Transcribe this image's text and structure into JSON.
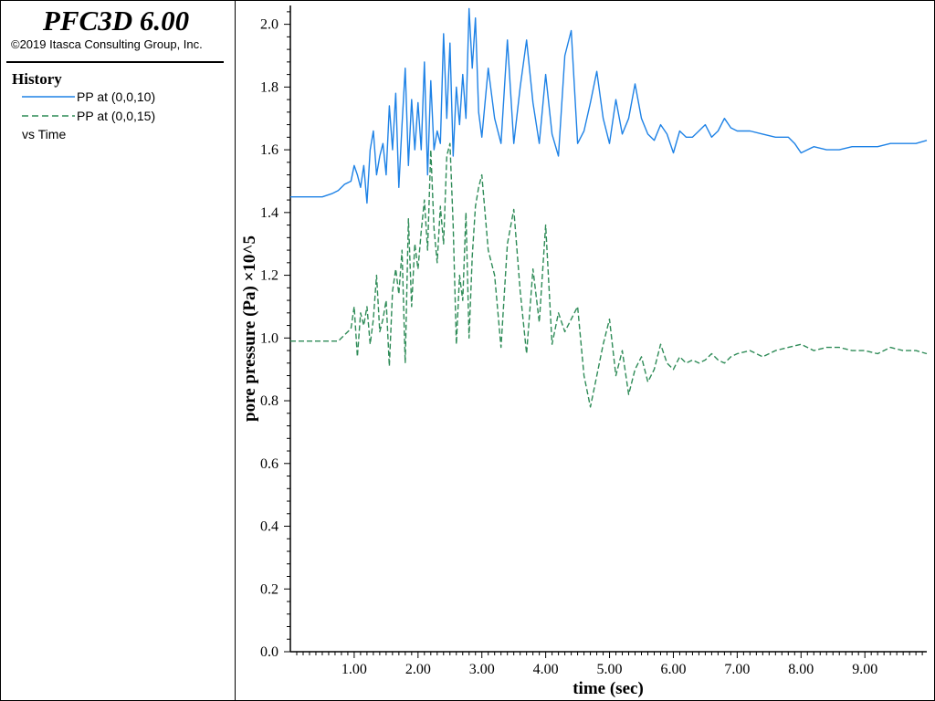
{
  "header": {
    "app_title": "PFC3D 6.00",
    "copyright": "©2019 Itasca Consulting Group, Inc."
  },
  "legend": {
    "heading": "History",
    "items": [
      {
        "label": "PP at (0,0,10)",
        "color": "#1e82e6",
        "style": "solid"
      },
      {
        "label": "PP at (0,0,15)",
        "color": "#2e8b57",
        "style": "dashed"
      }
    ],
    "vs_label": "vs Time"
  },
  "chart_data": {
    "type": "line",
    "xlabel": "time (sec)",
    "ylabel": "pore pressure (Pa) ×10^5",
    "xlim": [
      0,
      9.97
    ],
    "ylim": [
      0,
      2.06
    ],
    "xticks": [
      1,
      2,
      3,
      4,
      5,
      6,
      7,
      8,
      9
    ],
    "xtick_labels": [
      "1.00",
      "2.00",
      "3.00",
      "4.00",
      "5.00",
      "6.00",
      "7.00",
      "8.00",
      "9.00"
    ],
    "yticks": [
      0,
      0.2,
      0.4,
      0.6,
      0.8,
      1.0,
      1.2,
      1.4,
      1.6,
      1.8,
      2.0
    ],
    "ytick_labels": [
      "0.0",
      "0.2",
      "0.4",
      "0.6",
      "0.8",
      "1.0",
      "1.2",
      "1.4",
      "1.6",
      "1.8",
      "2.0"
    ],
    "grid": false,
    "legend_position": "left panel",
    "series": [
      {
        "name": "PP at (0,0,10)",
        "color": "#1e82e6",
        "dash": "solid",
        "x": [
          0,
          0.3,
          0.5,
          0.65,
          0.75,
          0.85,
          0.95,
          1.0,
          1.05,
          1.1,
          1.15,
          1.2,
          1.25,
          1.3,
          1.35,
          1.4,
          1.45,
          1.5,
          1.55,
          1.6,
          1.65,
          1.7,
          1.75,
          1.8,
          1.85,
          1.9,
          1.95,
          2.0,
          2.05,
          2.1,
          2.15,
          2.2,
          2.25,
          2.3,
          2.35,
          2.4,
          2.45,
          2.5,
          2.55,
          2.6,
          2.65,
          2.7,
          2.75,
          2.8,
          2.85,
          2.9,
          2.95,
          3.0,
          3.1,
          3.2,
          3.3,
          3.4,
          3.5,
          3.6,
          3.7,
          3.8,
          3.9,
          4.0,
          4.1,
          4.2,
          4.3,
          4.4,
          4.5,
          4.6,
          4.7,
          4.8,
          4.9,
          5.0,
          5.1,
          5.2,
          5.3,
          5.4,
          5.5,
          5.6,
          5.7,
          5.8,
          5.9,
          6.0,
          6.1,
          6.2,
          6.3,
          6.4,
          6.5,
          6.6,
          6.7,
          6.8,
          6.9,
          7.0,
          7.2,
          7.4,
          7.6,
          7.8,
          7.9,
          8.0,
          8.2,
          8.4,
          8.6,
          8.8,
          9.0,
          9.2,
          9.4,
          9.6,
          9.8,
          9.97
        ],
        "values": [
          1.45,
          1.45,
          1.45,
          1.46,
          1.47,
          1.49,
          1.5,
          1.55,
          1.52,
          1.48,
          1.55,
          1.43,
          1.6,
          1.66,
          1.52,
          1.58,
          1.62,
          1.52,
          1.74,
          1.6,
          1.78,
          1.48,
          1.68,
          1.86,
          1.55,
          1.76,
          1.6,
          1.75,
          1.6,
          1.88,
          1.52,
          1.82,
          1.6,
          1.66,
          1.62,
          1.97,
          1.7,
          1.94,
          1.58,
          1.8,
          1.68,
          1.84,
          1.7,
          2.05,
          1.86,
          2.02,
          1.72,
          1.64,
          1.86,
          1.7,
          1.62,
          1.95,
          1.62,
          1.8,
          1.95,
          1.75,
          1.62,
          1.84,
          1.65,
          1.58,
          1.9,
          1.98,
          1.62,
          1.66,
          1.75,
          1.85,
          1.7,
          1.62,
          1.76,
          1.65,
          1.7,
          1.81,
          1.7,
          1.65,
          1.63,
          1.68,
          1.65,
          1.59,
          1.66,
          1.64,
          1.64,
          1.66,
          1.68,
          1.64,
          1.66,
          1.7,
          1.67,
          1.66,
          1.66,
          1.65,
          1.64,
          1.64,
          1.62,
          1.59,
          1.61,
          1.6,
          1.6,
          1.61,
          1.61,
          1.61,
          1.62,
          1.62,
          1.62,
          1.63
        ]
      },
      {
        "name": "PP at (0,0,15)",
        "color": "#2e8b57",
        "dash": "dashed",
        "x": [
          0,
          0.3,
          0.6,
          0.75,
          0.85,
          0.95,
          1.0,
          1.05,
          1.1,
          1.15,
          1.2,
          1.25,
          1.3,
          1.35,
          1.4,
          1.45,
          1.5,
          1.55,
          1.6,
          1.65,
          1.7,
          1.75,
          1.8,
          1.85,
          1.9,
          1.95,
          2.0,
          2.05,
          2.1,
          2.15,
          2.2,
          2.25,
          2.3,
          2.35,
          2.4,
          2.45,
          2.5,
          2.55,
          2.6,
          2.65,
          2.7,
          2.75,
          2.8,
          2.85,
          2.9,
          2.95,
          3.0,
          3.1,
          3.2,
          3.3,
          3.4,
          3.5,
          3.6,
          3.7,
          3.8,
          3.9,
          4.0,
          4.1,
          4.2,
          4.3,
          4.4,
          4.5,
          4.6,
          4.7,
          4.8,
          4.9,
          5.0,
          5.1,
          5.2,
          5.3,
          5.4,
          5.5,
          5.6,
          5.7,
          5.8,
          5.9,
          6.0,
          6.1,
          6.2,
          6.3,
          6.4,
          6.5,
          6.6,
          6.7,
          6.8,
          6.9,
          7.0,
          7.2,
          7.4,
          7.6,
          7.8,
          8.0,
          8.2,
          8.4,
          8.6,
          8.8,
          9.0,
          9.2,
          9.4,
          9.6,
          9.8,
          9.97
        ],
        "values": [
          0.99,
          0.99,
          0.99,
          0.99,
          1.01,
          1.03,
          1.1,
          0.94,
          1.08,
          1.04,
          1.1,
          0.98,
          1.06,
          1.2,
          1.02,
          1.06,
          1.12,
          0.91,
          1.15,
          1.22,
          1.14,
          1.28,
          0.92,
          1.38,
          1.1,
          1.3,
          1.22,
          1.34,
          1.44,
          1.28,
          1.6,
          1.35,
          1.24,
          1.42,
          1.3,
          1.58,
          1.62,
          1.36,
          0.98,
          1.2,
          1.12,
          1.4,
          1.0,
          1.26,
          1.42,
          1.48,
          1.52,
          1.28,
          1.2,
          0.97,
          1.3,
          1.41,
          1.15,
          0.95,
          1.22,
          1.05,
          1.36,
          0.98,
          1.08,
          1.02,
          1.06,
          1.1,
          0.88,
          0.78,
          0.88,
          0.98,
          1.06,
          0.88,
          0.96,
          0.82,
          0.9,
          0.94,
          0.86,
          0.9,
          0.98,
          0.92,
          0.9,
          0.94,
          0.92,
          0.93,
          0.92,
          0.93,
          0.95,
          0.93,
          0.92,
          0.94,
          0.95,
          0.96,
          0.94,
          0.96,
          0.97,
          0.98,
          0.96,
          0.97,
          0.97,
          0.96,
          0.96,
          0.95,
          0.97,
          0.96,
          0.96,
          0.95
        ]
      }
    ]
  }
}
